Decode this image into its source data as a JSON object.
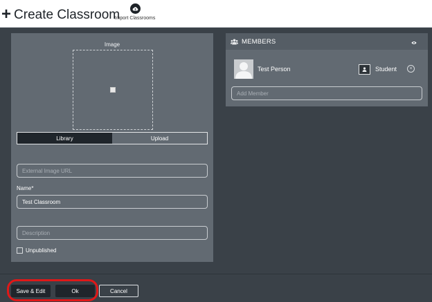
{
  "header": {
    "title": "Create Classroom",
    "plus_glyph": "+",
    "import_label": "Import Classrooms",
    "import_icon": "cloud-upload-icon"
  },
  "image_section": {
    "label": "Image",
    "tabs": [
      {
        "label": "Library",
        "active": true
      },
      {
        "label": "Upload",
        "active": false
      }
    ],
    "external_url_placeholder": "External Image URL"
  },
  "form": {
    "name_label": "Name*",
    "name_value": "Test Classroom",
    "description_placeholder": "Description",
    "unpublished_label": "Unpublished",
    "unpublished_checked": false
  },
  "members": {
    "title": "MEMBERS",
    "header_icon": "group-icon",
    "visibility_icon": "eye-icon",
    "list": [
      {
        "name": "Test Person",
        "role": "Student",
        "role_icon": "person-icon",
        "remove_icon": "remove-circle-icon"
      }
    ],
    "add_placeholder": "Add Member"
  },
  "footer": {
    "save_edit_label": "Save & Edit",
    "ok_label": "Ok",
    "cancel_label": "Cancel"
  },
  "colors": {
    "background": "#3a4148",
    "panel": "#626a72",
    "dark_button": "#1f252b",
    "highlight": "#e01818"
  }
}
